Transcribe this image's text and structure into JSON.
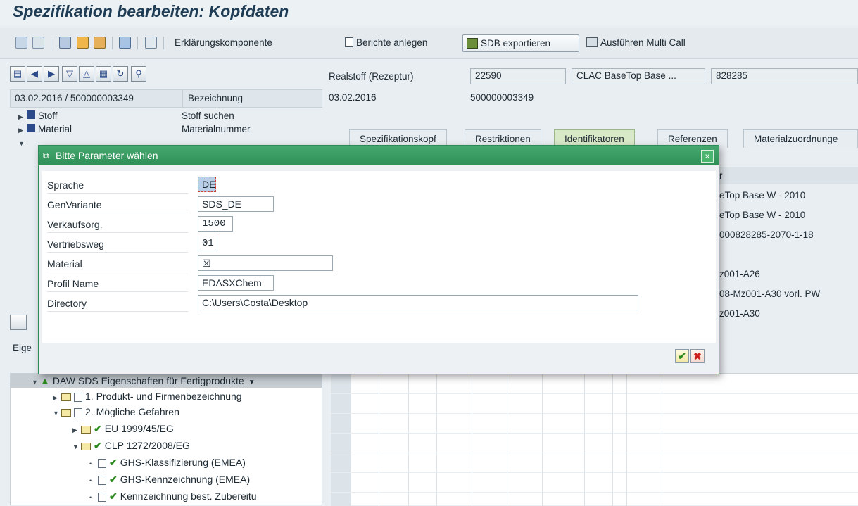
{
  "window": {
    "title": "Spezifikation bearbeiten: Kopfdaten"
  },
  "toolbar": {
    "erklaerung_label": "Erklärungskomponente",
    "berichte_label": "Berichte anlegen",
    "sdb_label": "SDB exportieren",
    "multicall_label": "Ausführen Multi Call"
  },
  "left_header": {
    "date_id": "03.02.2016 / 500000003349",
    "bezeichnung": "Bezeichnung",
    "rows": [
      {
        "label": "Stoff",
        "value": "Stoff suchen"
      },
      {
        "label": "Material",
        "value": "Materialnummer"
      }
    ],
    "section_label": "Eige"
  },
  "spec": {
    "type_label": "Realstoff (Rezeptur)",
    "number": "22590",
    "name": "CLAC BaseTop Base ...",
    "code": "828285",
    "date": "03.02.2016",
    "id": "500000003349"
  },
  "tabs": [
    {
      "label": "Spezifikationskopf",
      "active": false
    },
    {
      "label": "Restriktionen",
      "active": false
    },
    {
      "label": "Identifikatoren",
      "active": true
    },
    {
      "label": "Referenzen",
      "active": false
    },
    {
      "label": "Materialzuordnunge",
      "active": false
    }
  ],
  "right_table": {
    "header_fragment": "r",
    "rows": [
      "eTop Base W - 2010",
      "eTop Base W - 2010",
      "000828285-2070-1-18",
      "",
      "z001-A26",
      "08-Mz001-A30 vorl. PW",
      "z001-A30"
    ]
  },
  "tree": {
    "root": "DAW SDS Eigenschaften für Fertigprodukte",
    "items": [
      {
        "label": "1. Produkt- und Firmenbezeichnung"
      },
      {
        "label": "2. Mögliche Gefahren"
      },
      {
        "label": "EU 1999/45/EG"
      },
      {
        "label": "CLP 1272/2008/EG"
      },
      {
        "label": "GHS-Klassifizierung (EMEA)"
      },
      {
        "label": "GHS-Kennzeichnung (EMEA)"
      },
      {
        "label": "Kennzeichnung best. Zubereitu"
      }
    ]
  },
  "dialog": {
    "title": "Bitte Parameter wählen",
    "params": [
      {
        "label": "Sprache",
        "value": "DE"
      },
      {
        "label": "GenVariante",
        "value": "SDS_DE"
      },
      {
        "label": "Verkaufsorg.",
        "value": "1500"
      },
      {
        "label": "Vertriebsweg",
        "value": "01"
      },
      {
        "label": "Material",
        "value": "☒"
      },
      {
        "label": "Profil Name",
        "value": "EDASXChem"
      },
      {
        "label": "Directory",
        "value": "C:\\Users\\Costa\\Desktop"
      }
    ],
    "ok": "✔",
    "cancel": "✖",
    "close": "×"
  },
  "colors": {
    "dialog_title": "#2e8f57",
    "page_bg": "#e9eef2",
    "active_tab": "#d8e9c8"
  }
}
